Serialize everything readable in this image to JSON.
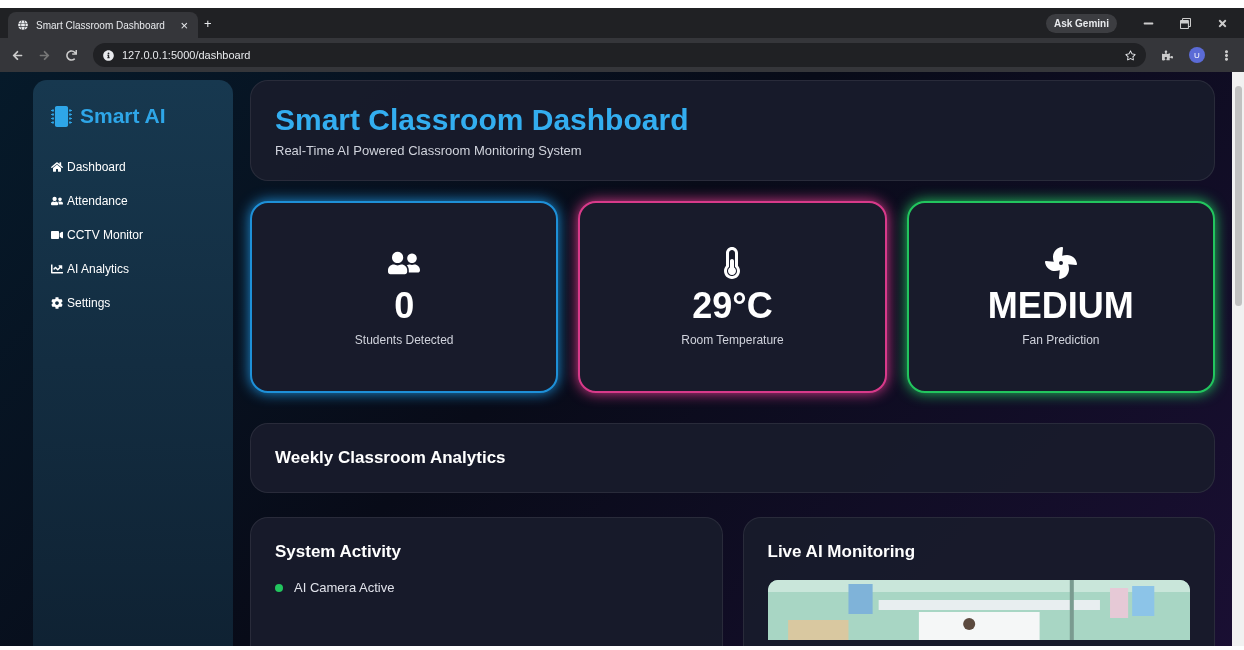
{
  "browser": {
    "tab_title": "Smart Classroom Dashboard",
    "close_tab": "×",
    "new_tab": "+",
    "address": "127.0.0.1:5000/dashboard",
    "gemini": "Ask Gemini",
    "profile": "U"
  },
  "sidebar": {
    "brand": "Smart AI",
    "items": [
      {
        "label": "Dashboard",
        "kind": "home"
      },
      {
        "label": "Attendance",
        "kind": "users"
      },
      {
        "label": "CCTV Monitor",
        "kind": "video"
      },
      {
        "label": "AI Analytics",
        "kind": "chart"
      },
      {
        "label": "Settings",
        "kind": "settings"
      }
    ]
  },
  "header": {
    "title": "Smart Classroom Dashboard",
    "subtitle": "Real-Time AI Powered Classroom Monitoring System"
  },
  "stats": [
    {
      "kind": "users",
      "value": "0",
      "label": "Students Detected",
      "color": "#1e90d8"
    },
    {
      "kind": "temperature",
      "value": "29°C",
      "label": "Room Temperature",
      "color": "#d83a8a"
    },
    {
      "kind": "fan",
      "value": "MEDIUM",
      "label": "Fan Prediction",
      "color": "#22c55e"
    }
  ],
  "weekly": {
    "title": "Weekly Classroom Analytics"
  },
  "activity": {
    "title": "System Activity",
    "items": [
      {
        "label": "AI Camera Active",
        "color": "#22c55e"
      }
    ]
  },
  "monitoring": {
    "title": "Live AI Monitoring"
  }
}
